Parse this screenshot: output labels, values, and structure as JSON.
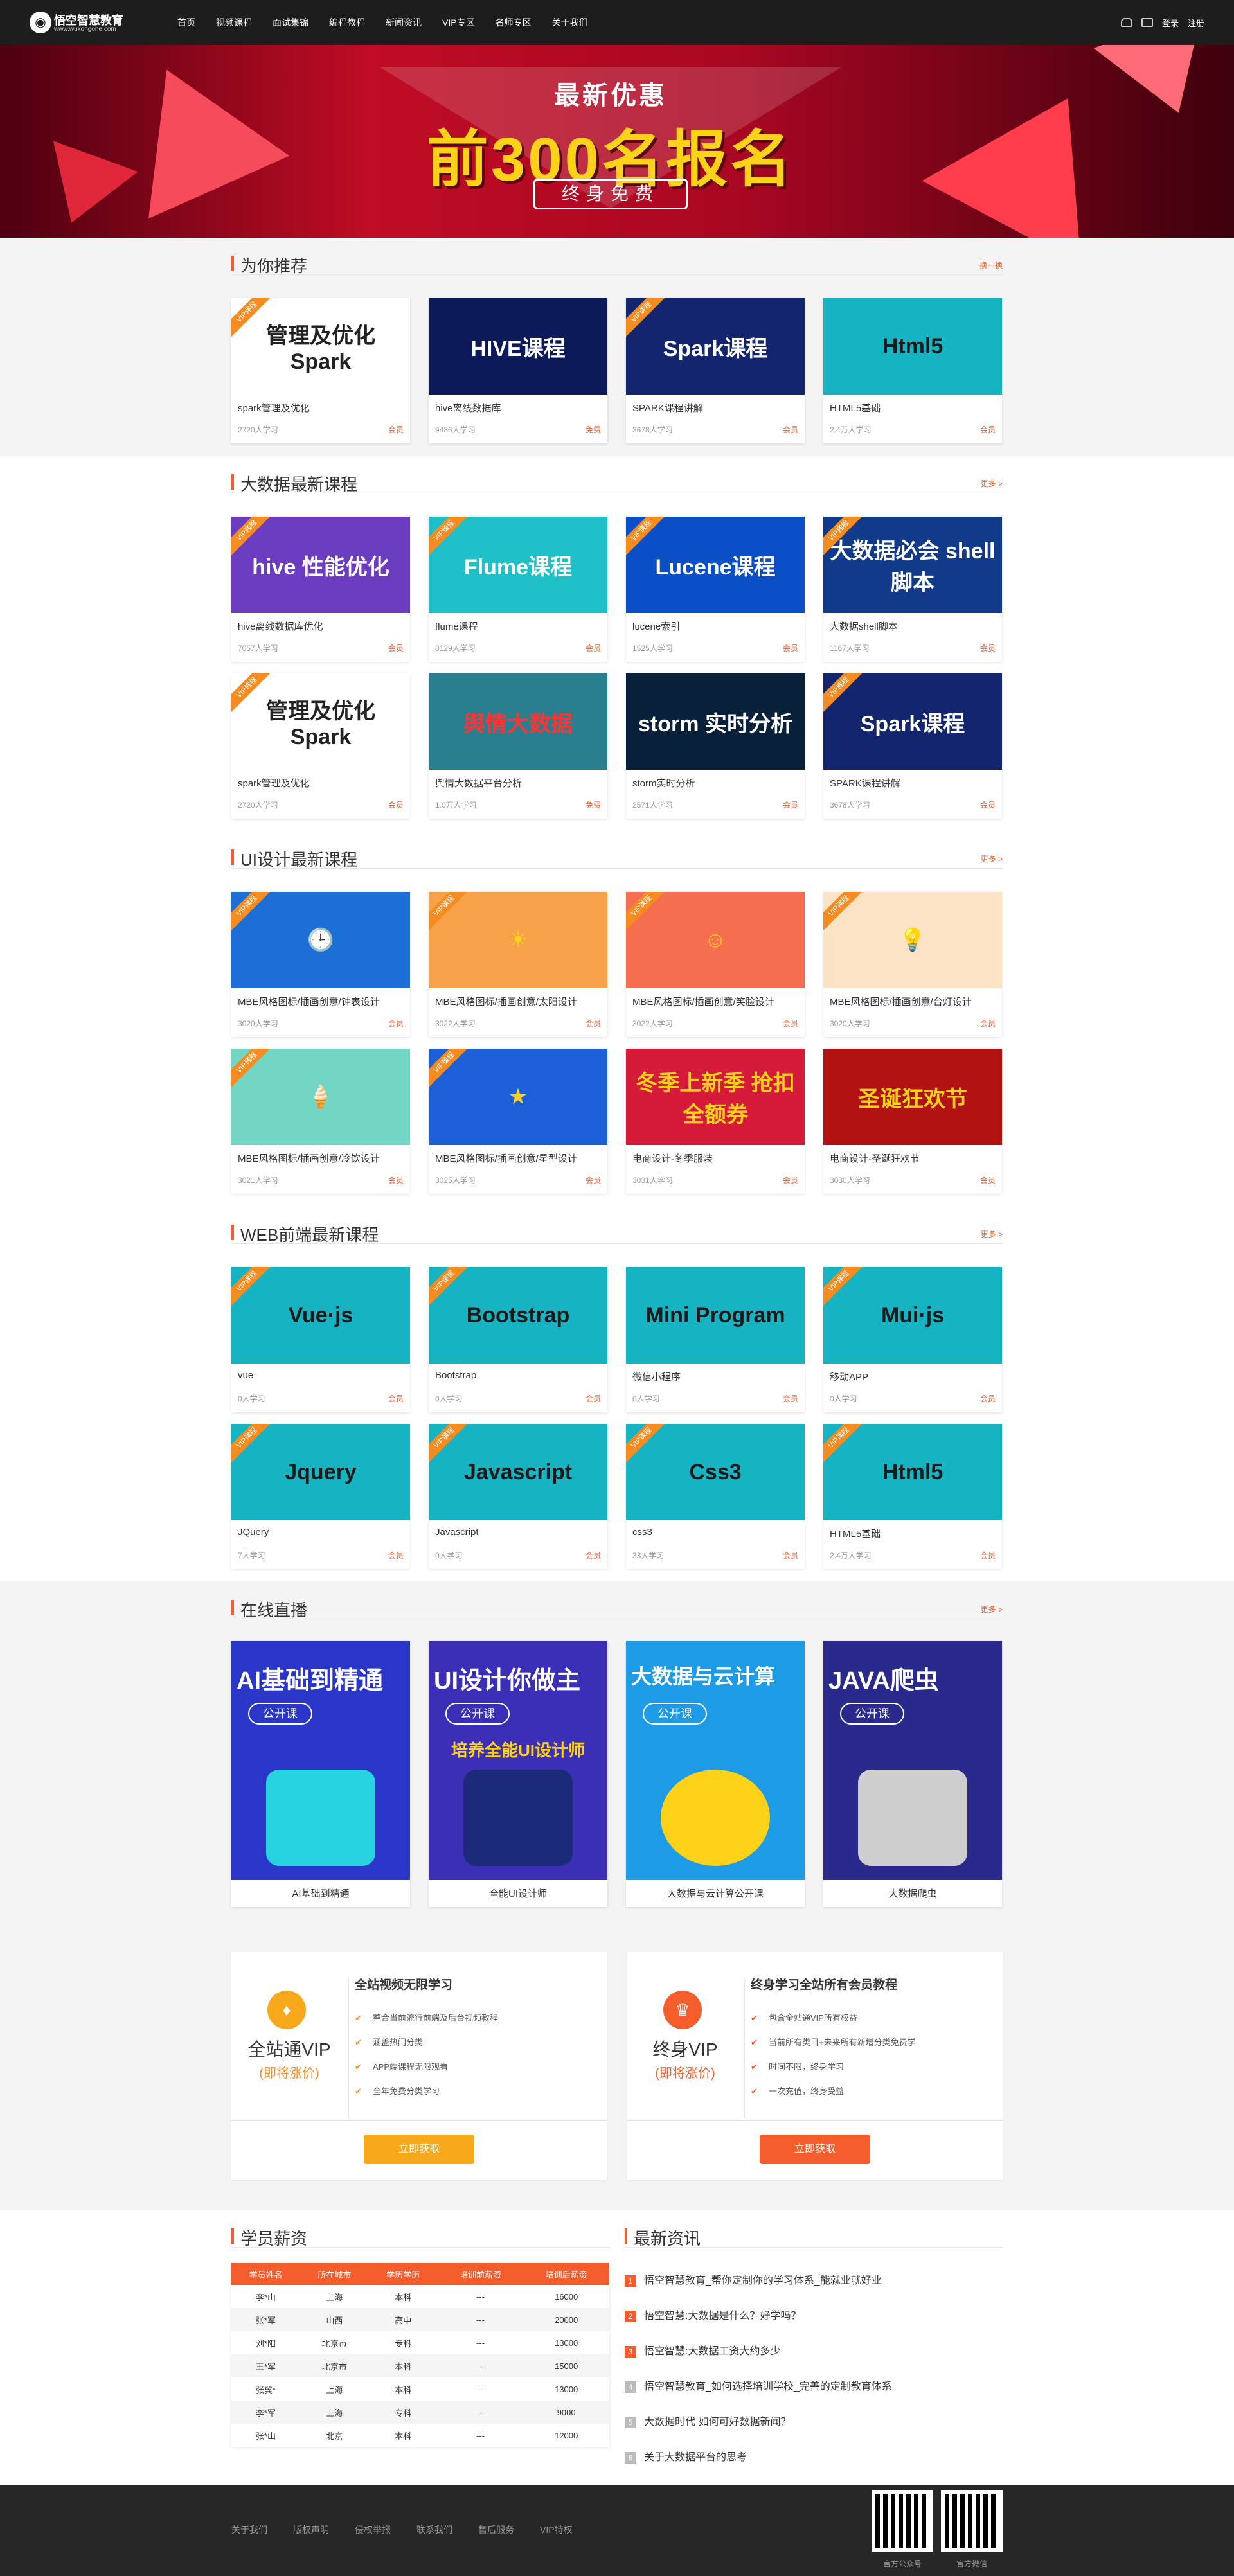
{
  "nav": {
    "logo_name": "悟空智慧教育",
    "logo_url": "www.wukongone.com",
    "links": [
      "首页",
      "视频课程",
      "面试集锦",
      "编程教程",
      "新闻资讯",
      "VIP专区",
      "名师专区",
      "关于我们"
    ],
    "login": "登录",
    "register": "注册",
    "icons": [
      "user-icon",
      "mail-icon"
    ]
  },
  "banner": {
    "top": "最新优惠",
    "main": "前300名报名",
    "sub": "终身免费"
  },
  "sections": {
    "recommend": {
      "title": "为你推荐",
      "more": "换一换",
      "cards": [
        {
          "thumb": "管理及优化 Spark",
          "name": "spark管理及优化",
          "count": "2720人学习",
          "tag": "会员",
          "vip": true,
          "bg": "#ffffff",
          "fg": "#222222"
        },
        {
          "thumb": "HIVE课程",
          "name": "hive离线数据库",
          "count": "9486人学习",
          "tag": "免费",
          "vip": false,
          "bg": "#0c1a5a",
          "fg": "#ffffff"
        },
        {
          "thumb": "Spark课程",
          "name": "SPARK课程讲解",
          "count": "3678人学习",
          "tag": "会员",
          "vip": true,
          "bg": "#12256e",
          "fg": "#ffffff"
        },
        {
          "thumb": "Html5",
          "name": "HTML5基础",
          "count": "2.4万人学习",
          "tag": "会员",
          "vip": false,
          "bg": "#16b3c3",
          "fg": "#1a1a1a"
        }
      ]
    },
    "bigdata": {
      "title": "大数据最新课程",
      "more": "更多 >",
      "cards": [
        {
          "thumb": "hive 性能优化",
          "name": "hive离线数据库优化",
          "count": "7057人学习",
          "tag": "会员",
          "vip": true,
          "bg": "#6b3cc0",
          "fg": "#ffffff"
        },
        {
          "thumb": "Flume课程",
          "name": "flume课程",
          "count": "8129人学习",
          "tag": "会员",
          "vip": true,
          "bg": "#1fc0c8",
          "fg": "#ffffff"
        },
        {
          "thumb": "Lucene课程",
          "name": "lucene索引",
          "count": "1525人学习",
          "tag": "会员",
          "vip": true,
          "bg": "#0b4fc6",
          "fg": "#ffffff"
        },
        {
          "thumb": "大数据必会 shell脚本",
          "name": "大数据shell脚本",
          "count": "1167人学习",
          "tag": "会员",
          "vip": true,
          "bg": "#123a8a",
          "fg": "#ffffff"
        },
        {
          "thumb": "管理及优化 Spark",
          "name": "spark管理及优化",
          "count": "2720人学习",
          "tag": "会员",
          "vip": true,
          "bg": "#ffffff",
          "fg": "#222222"
        },
        {
          "thumb": "舆情大数据",
          "name": "舆情大数据平台分析",
          "count": "1.0万人学习",
          "tag": "免费",
          "vip": false,
          "bg": "#2a7f8f",
          "fg": "#ff3333"
        },
        {
          "thumb": "storm 实时分析",
          "name": "storm实时分析",
          "count": "2571人学习",
          "tag": "会员",
          "vip": false,
          "bg": "#08203a",
          "fg": "#ffffff"
        },
        {
          "thumb": "Spark课程",
          "name": "SPARK课程讲解",
          "count": "3678人学习",
          "tag": "会员",
          "vip": true,
          "bg": "#12256e",
          "fg": "#ffffff"
        }
      ]
    },
    "ui": {
      "title": "UI设计最新课程",
      "more": "更多 >",
      "cards": [
        {
          "thumb": "🕒",
          "name": "MBE风格图标/插画创意/钟表设计",
          "count": "3020人学习",
          "tag": "会员",
          "vip": true,
          "bg": "#1c6fd6",
          "fg": "#ffffff"
        },
        {
          "thumb": "☀",
          "name": "MBE风格图标/插画创意/太阳设计",
          "count": "3022人学习",
          "tag": "会员",
          "vip": true,
          "bg": "#f7a24a",
          "fg": "#ffd21a"
        },
        {
          "thumb": "☺",
          "name": "MBE风格图标/插画创意/笑脸设计",
          "count": "3022人学习",
          "tag": "会员",
          "vip": true,
          "bg": "#f66e50",
          "fg": "#ffd21a"
        },
        {
          "thumb": "💡",
          "name": "MBE风格图标/插画创意/台灯设计",
          "count": "3020人学习",
          "tag": "会员",
          "vip": true,
          "bg": "#fde3c6",
          "fg": "#d99b1a"
        },
        {
          "thumb": "🍦",
          "name": "MBE风格图标/插画创意/冷饮设计",
          "count": "3021人学习",
          "tag": "会员",
          "vip": true,
          "bg": "#73d6c4",
          "fg": "#1c6fd6"
        },
        {
          "thumb": "★",
          "name": "MBE风格图标/插画创意/星型设计",
          "count": "3025人学习",
          "tag": "会员",
          "vip": true,
          "bg": "#1c5fd6",
          "fg": "#ffd21a"
        },
        {
          "thumb": "冬季上新季 抢扣全额券",
          "name": "电商设计-冬季服装",
          "count": "3031人学习",
          "tag": "会员",
          "vip": false,
          "bg": "#d61a3a",
          "fg": "#ffd21a"
        },
        {
          "thumb": "圣诞狂欢节",
          "name": "电商设计-圣诞狂欢节",
          "count": "3030人学习",
          "tag": "会员",
          "vip": false,
          "bg": "#b31212",
          "fg": "#ffd21a"
        }
      ]
    },
    "web": {
      "title": "WEB前端最新课程",
      "more": "更多 >",
      "cards": [
        {
          "thumb": "Vue·js",
          "name": "vue",
          "count": "0人学习",
          "tag": "会员",
          "vip": true,
          "bg": "#16b3c3",
          "fg": "#1a1a1a"
        },
        {
          "thumb": "Bootstrap",
          "name": "Bootstrap",
          "count": "0人学习",
          "tag": "会员",
          "vip": true,
          "bg": "#16b3c3",
          "fg": "#1a1a1a"
        },
        {
          "thumb": "Mini Program",
          "name": "微信小程序",
          "count": "0人学习",
          "tag": "会员",
          "vip": false,
          "bg": "#16b3c3",
          "fg": "#1a1a1a"
        },
        {
          "thumb": "Mui·js",
          "name": "移动APP",
          "count": "0人学习",
          "tag": "会员",
          "vip": true,
          "bg": "#16b3c3",
          "fg": "#1a1a1a"
        },
        {
          "thumb": "Jquery",
          "name": "JQuery",
          "count": "7人学习",
          "tag": "会员",
          "vip": true,
          "bg": "#16b3c3",
          "fg": "#1a1a1a"
        },
        {
          "thumb": "Javascript",
          "name": "Javascript",
          "count": "0人学习",
          "tag": "会员",
          "vip": true,
          "bg": "#16b3c3",
          "fg": "#1a1a1a"
        },
        {
          "thumb": "Css3",
          "name": "css3",
          "count": "33人学习",
          "tag": "会员",
          "vip": true,
          "bg": "#16b3c3",
          "fg": "#1a1a1a"
        },
        {
          "thumb": "Html5",
          "name": "HTML5基础",
          "count": "2.4万人学习",
          "tag": "会员",
          "vip": true,
          "bg": "#16b3c3",
          "fg": "#1a1a1a"
        }
      ]
    },
    "live": {
      "title": "在线直播",
      "more": "更多 >",
      "open_label": "公开课",
      "cards": [
        {
          "poster": "AI基础到精通",
          "sub": "",
          "name": "AI基础到精通",
          "bg": "#2a36c8",
          "art": "#27d3e0"
        },
        {
          "poster": "UI设计你做主",
          "sub": "培养全能UI设计师",
          "name": "全能UI设计师",
          "bg": "#3b2fb8",
          "art": "#1c2a7a"
        },
        {
          "poster": "大数据与云计算",
          "sub": "",
          "name": "大数据与云计算公开课",
          "bg": "#1e9be6",
          "art": "#ffd21a"
        },
        {
          "poster": "JAVA爬虫",
          "sub": "",
          "name": "大数据爬虫",
          "bg": "#2a2a8c",
          "art": "#cfcfcf"
        }
      ]
    }
  },
  "vip": [
    {
      "badge": "♦",
      "name": "全站通VIP",
      "price": "(即将涨价)",
      "title": "全站视频无限学习",
      "items": [
        "整合当前流行前端及后台视频教程",
        "涵盖热门分类",
        "APP端课程无限观看",
        "全年免费分类学习"
      ],
      "button": "立即获取",
      "color": "#f7a81b"
    },
    {
      "badge": "♛",
      "name": "终身VIP",
      "price": "(即将涨价)",
      "title": "终身学习全站所有会员教程",
      "items": [
        "包含全站通VIP所有权益",
        "当前所有类目+未来所有新增分类免费学",
        "时间不限，终身学习",
        "一次充值，终身受益"
      ],
      "button": "立即获取",
      "color": "#f55d2d"
    }
  ],
  "salary": {
    "title": "学员薪资",
    "headers": [
      "学员姓名",
      "所在城市",
      "学历学历",
      "培训前薪资",
      "培训后薪资"
    ],
    "rows": [
      [
        "李*山",
        "上海",
        "本科",
        "---",
        "16000"
      ],
      [
        "张*军",
        "山西",
        "高中",
        "---",
        "20000"
      ],
      [
        "刘*阳",
        "北京市",
        "专科",
        "---",
        "13000"
      ],
      [
        "王*军",
        "北京市",
        "本科",
        "---",
        "15000"
      ],
      [
        "张冀*",
        "上海",
        "本科",
        "---",
        "13000"
      ],
      [
        "李*军",
        "上海",
        "专科",
        "---",
        "9000"
      ],
      [
        "张*山",
        "北京",
        "本科",
        "---",
        "12000"
      ]
    ]
  },
  "news": {
    "title": "最新资讯",
    "items": [
      "悟空智慧教育_帮你定制你的学习体系_能就业就好业",
      "悟空智慧:大数据是什么？好学吗？",
      "悟空智慧:大数据工资大约多少",
      "悟空智慧教育_如何选择培训学校_完善的定制教育体系",
      "大数据时代 如何可好数据新闻？",
      "关于大数据平台的思考"
    ]
  },
  "footer": {
    "links": [
      "关于我们",
      "版权声明",
      "侵权举报",
      "联系我们",
      "售后服务",
      "VIP特权"
    ],
    "qr1": "官方公众号",
    "qr2": "官方微信"
  }
}
